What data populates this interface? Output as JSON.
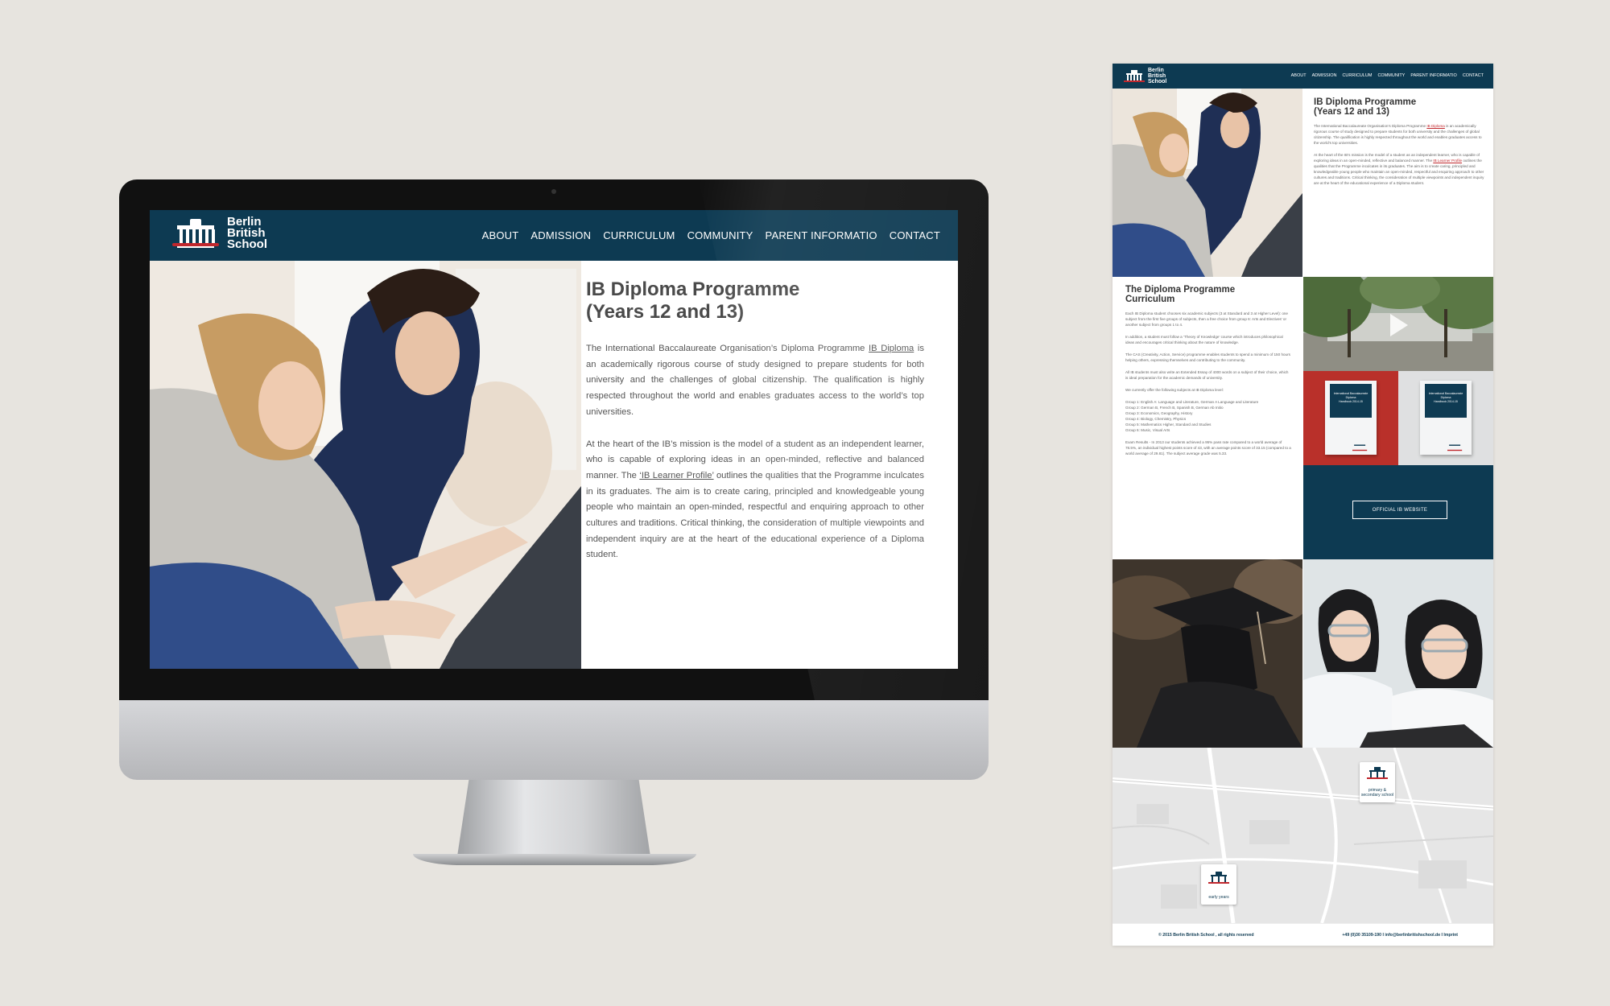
{
  "desktop": {
    "logo": {
      "line1": "Berlin",
      "line2": "British",
      "line3": "School"
    },
    "nav": [
      "ABOUT",
      "ADMISSION",
      "CURRICULUM",
      "COMMUNITY",
      "PARENT INFORMATIO",
      "CONTACT"
    ],
    "title_line1": "IB Diploma Programme",
    "title_line2": "(Years 12 and 13)",
    "para1_a": "The International Baccalaureate Organisation’s Diploma Programme ",
    "para1_link": "IB Diploma",
    "para1_b": " is an academically rigorous course of study designed to prepare students for both university and the challenges of global citizenship. The qualification is highly respected throughout the world and enables graduates access to the world’s top universities.",
    "para2_a": "At the heart of the IB’s mission is the model of a student as an independent learner, who is capable of exploring ideas in an open-minded, reflective and balanced manner. The ",
    "para2_link": "‘IB Learner Profile’",
    "para2_b": " outlines the qualities that the Programme inculcates in its graduates. The aim is to create caring, principled and knowledgeable young people who maintain an open-minded, respectful and enquiring approach to other cultures and traditions. Critical thinking, the consideration of multiple viewpoints and independent inquiry are at the heart of the educational experience of a Diploma student."
  },
  "fullpage": {
    "logo": {
      "line1": "Berlin",
      "line2": "British",
      "line3": "School"
    },
    "nav": [
      "ABOUT",
      "ADMISSION",
      "CURRICULUM",
      "COMMUNITY",
      "PARENT INFORMATIO",
      "CONTACT"
    ],
    "title_line1": "IB Diploma Programme",
    "title_line2": "(Years 12 and 13)",
    "intro_a": "The International Baccalaureate Organisation’s Diploma Programme ",
    "intro_link": "IB Diploma",
    "intro_b": " is an academically rigorous course of study designed to prepare students for both university and the challenges of global citizenship. The qualification is highly respected throughout the world and enables graduates access to the world’s top universities.",
    "intro2_a": "At the heart of the IB’s mission is the model of a student as an independent learner, who is capable of exploring ideas in an open-minded, reflective and balanced manner. The ",
    "intro2_link": "IB Learner Profile",
    "intro2_b": " outlines the qualities that the Programme inculcates in its graduates. The aim is to create caring, principled and knowledgeable young people who maintain an open-minded, respectful and enquiring approach to other cultures and traditions. Critical thinking, the consideration of multiple viewpoints and independent inquiry are at the heart of the educational experience of a Diploma student.",
    "curriculum_title_line1": "The Diploma Programme",
    "curriculum_title_line2": "Curriculum",
    "cur_p1": "Each IB Diploma student chooses six academic subjects (3 at Standard and 3 at Higher Level): one subject from the first five groups of subjects, then a free choice from group 6: Arts and Electives’ or another subject from groups 1 to 4.",
    "cur_p2": "In addition, a student must follow a ‘Theory of Knowledge’ course which introduces philosophical ideas and encourages critical thinking about the nature of knowledge.",
    "cur_p3": "The CAS (Creativity, Action, Service) programme enables students to spend a minimum of 150 hours helping others, expressing themselves and contributing to the community.",
    "cur_p4": "All IB students must also write an Extended Essay of 4000 words on a subject of their choice, which is ideal preparation for the academic demands of university.",
    "cur_p5": "We currently offer the following subjects at IB Diploma level:",
    "groups": [
      "Group 1: English A: Language and Literature, German A Language and Literature",
      "Group 2: German B, French B, Spanish B, German Ab Initio",
      "Group 3: Economics, Geography, History",
      "Group 4: Biology, Chemistry, Physics",
      "Group 5: Mathematics Higher, Standard and Studies",
      "Group 6: Music, Visual Arts"
    ],
    "exam_results": "Exam Results - In 2013 our students achieved a 95% pass rate compared to a world average of 78.5%, an individual highest points score of 43, with an average points score of 33.15 (compared to a world average of 29.81). The subject average grade was 5.33.",
    "book_title": "International Baccalaureate Diploma",
    "book_sub": "Handbook 2014-15",
    "official_button": "OFFICIAL IB WEBSITE",
    "map_pin1": "primary & secondary school",
    "map_pin2": "early years",
    "footer_left": "© 2015 Berlin British School , all rights reserved",
    "footer_right": "+49 (0)30 35109-190 I info@berlinbritishschool.de I Imprint"
  }
}
